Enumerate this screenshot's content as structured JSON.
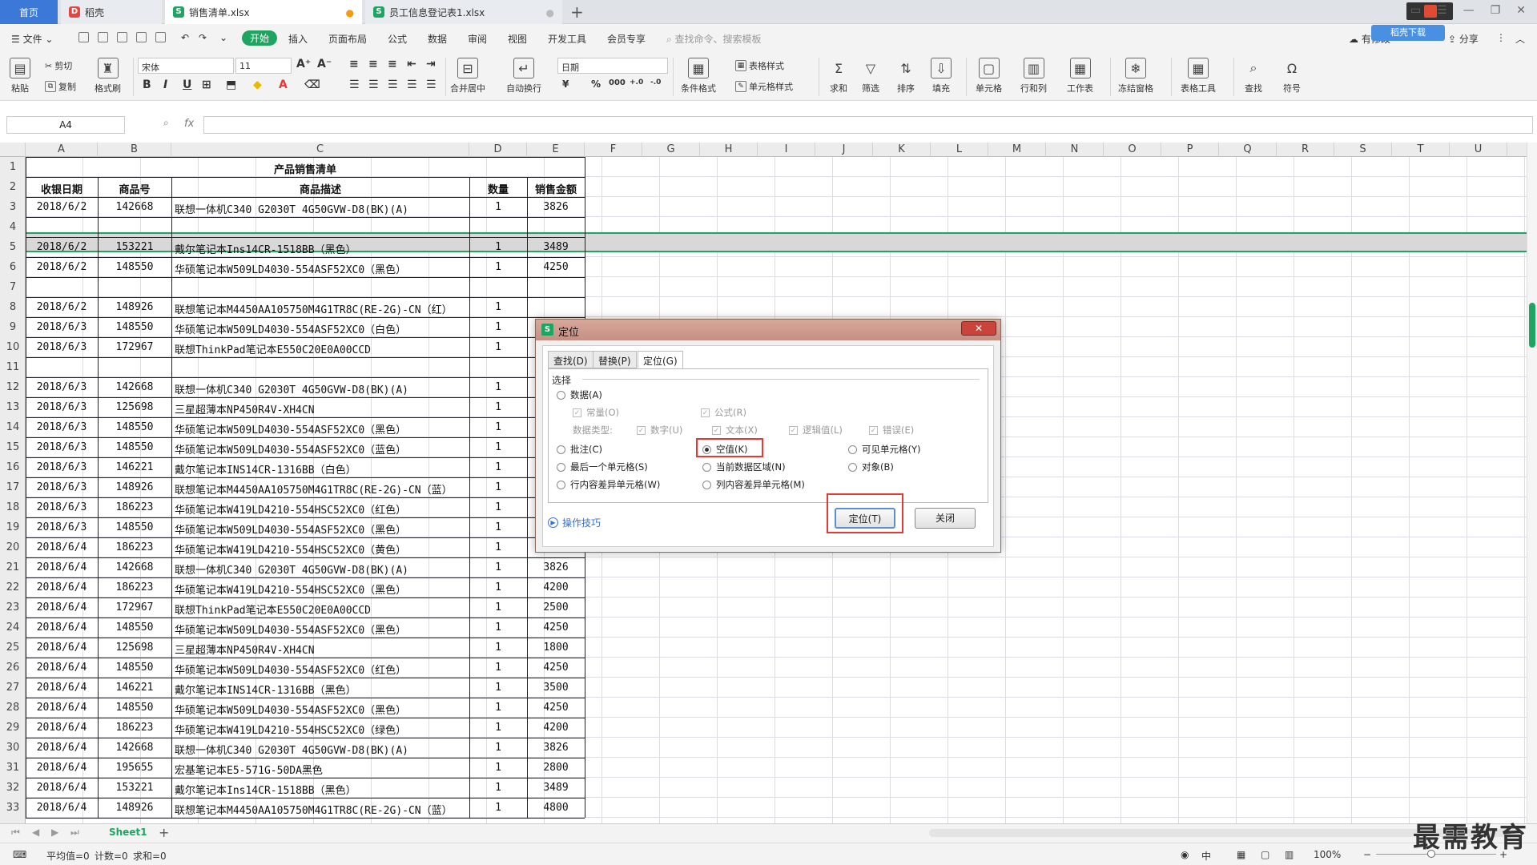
{
  "tabs": {
    "home": "首页",
    "t1": "稻壳",
    "t2": "销售清单.xlsx",
    "t3": "员工信息登记表1.xlsx",
    "new": "+"
  },
  "menubar": {
    "file": "文件",
    "items": [
      "开始",
      "插入",
      "页面布局",
      "公式",
      "数据",
      "审阅",
      "视图",
      "开发工具",
      "会员专享"
    ],
    "search_placeholder": "查找命令、搜索模板",
    "right": [
      "有修改",
      "分享"
    ],
    "badge": "稻壳下载"
  },
  "ribbon": {
    "paste": "粘贴",
    "cut": "剪切",
    "copy": "复制",
    "format_painter": "格式刷",
    "font_name": "宋体",
    "font_size": "11",
    "merge": "合并居中",
    "wrap": "自动换行",
    "number_format": "日期",
    "cond_format": "条件格式",
    "table_style": "表格样式",
    "cell_style": "单元格样式",
    "sum": "求和",
    "filter": "筛选",
    "sort": "排序",
    "fill": "填充",
    "cell": "单元格",
    "rowcol": "行和列",
    "sheet": "工作表",
    "freeze": "冻结窗格",
    "table_tools": "表格工具",
    "find": "查找",
    "symbol": "符号"
  },
  "formula": {
    "namebox": "A4",
    "fx": "fx",
    "value": ""
  },
  "columns": [
    "A",
    "B",
    "C",
    "D",
    "E",
    "F",
    "G",
    "H",
    "I",
    "J",
    "K",
    "L",
    "M",
    "N",
    "O",
    "P",
    "Q",
    "R",
    "S",
    "T",
    "U"
  ],
  "rows": [
    "1",
    "2",
    "3",
    "4",
    "5",
    "6",
    "7",
    "8",
    "9",
    "10",
    "11",
    "12",
    "13",
    "14",
    "15",
    "16",
    "17",
    "18",
    "19",
    "20",
    "21",
    "22",
    "23",
    "24",
    "25",
    "26",
    "27",
    "28",
    "29",
    "30",
    "31",
    "32",
    "33"
  ],
  "sheet": {
    "title": "产品销售清单",
    "headers": [
      "收银日期",
      "商品号",
      "商品描述",
      "数量",
      "销售金额"
    ],
    "data": [
      [
        "2018/6/2",
        "142668",
        "联想一体机C340 G2030T 4G50GVW-D8(BK)(A)",
        "1",
        "3826"
      ],
      [
        "",
        "",
        "",
        "",
        ""
      ],
      [
        "2018/6/2",
        "153221",
        "戴尔笔记本Ins14CR-1518BB（黑色）",
        "1",
        "3489"
      ],
      [
        "2018/6/2",
        "148550",
        "华硕笔记本W509LD4030-554ASF52XC0（黑色）",
        "1",
        "4250"
      ],
      [
        "",
        "",
        "",
        "",
        ""
      ],
      [
        "2018/6/2",
        "148926",
        "联想笔记本M4450AA105750M4G1TR8C(RE-2G)-CN（红）",
        "1",
        ""
      ],
      [
        "2018/6/3",
        "148550",
        "华硕笔记本W509LD4030-554ASF52XC0（白色）",
        "1",
        ""
      ],
      [
        "2018/6/3",
        "172967",
        "联想ThinkPad笔记本E550C20E0A00CCD",
        "1",
        ""
      ],
      [
        "",
        "",
        "",
        "",
        ""
      ],
      [
        "2018/6/3",
        "142668",
        "联想一体机C340 G2030T 4G50GVW-D8(BK)(A)",
        "1",
        ""
      ],
      [
        "2018/6/3",
        "125698",
        "三星超薄本NP450R4V-XH4CN",
        "1",
        ""
      ],
      [
        "2018/6/3",
        "148550",
        "华硕笔记本W509LD4030-554ASF52XC0（黑色）",
        "1",
        ""
      ],
      [
        "2018/6/3",
        "148550",
        "华硕笔记本W509LD4030-554ASF52XC0（蓝色）",
        "1",
        ""
      ],
      [
        "2018/6/3",
        "146221",
        "戴尔笔记本INS14CR-1316BB（白色）",
        "1",
        ""
      ],
      [
        "2018/6/3",
        "148926",
        "联想笔记本M4450AA105750M4G1TR8C(RE-2G)-CN（蓝）",
        "1",
        ""
      ],
      [
        "2018/6/3",
        "186223",
        "华硕笔记本W419LD4210-554HSC52XC0（红色）",
        "1",
        ""
      ],
      [
        "2018/6/3",
        "148550",
        "华硕笔记本W509LD4030-554ASF52XC0（黑色）",
        "1",
        ""
      ],
      [
        "2018/6/4",
        "186223",
        "华硕笔记本W419LD4210-554HSC52XC0（黄色）",
        "1",
        "4200"
      ],
      [
        "2018/6/4",
        "142668",
        "联想一体机C340 G2030T 4G50GVW-D8(BK)(A)",
        "1",
        "3826"
      ],
      [
        "2018/6/4",
        "186223",
        "华硕笔记本W419LD4210-554HSC52XC0（黑色）",
        "1",
        "4200"
      ],
      [
        "2018/6/4",
        "172967",
        "联想ThinkPad笔记本E550C20E0A00CCD",
        "1",
        "2500"
      ],
      [
        "2018/6/4",
        "148550",
        "华硕笔记本W509LD4030-554ASF52XC0（黑色）",
        "1",
        "4250"
      ],
      [
        "2018/6/4",
        "125698",
        "三星超薄本NP450R4V-XH4CN",
        "1",
        "1800"
      ],
      [
        "2018/6/4",
        "148550",
        "华硕笔记本W509LD4030-554ASF52XC0（红色）",
        "1",
        "4250"
      ],
      [
        "2018/6/4",
        "146221",
        "戴尔笔记本INS14CR-1316BB（黑色）",
        "1",
        "3500"
      ],
      [
        "2018/6/4",
        "148550",
        "华硕笔记本W509LD4030-554ASF52XC0（黑色）",
        "1",
        "4250"
      ],
      [
        "2018/6/4",
        "186223",
        "华硕笔记本W419LD4210-554HSC52XC0（绿色）",
        "1",
        "4200"
      ],
      [
        "2018/6/4",
        "142668",
        "联想一体机C340 G2030T 4G50GVW-D8(BK)(A)",
        "1",
        "3826"
      ],
      [
        "2018/6/4",
        "195655",
        "宏基笔记本E5-571G-50DA黑色",
        "1",
        "2800"
      ],
      [
        "2018/6/4",
        "153221",
        "戴尔笔记本Ins14CR-1518BB（黑色）",
        "1",
        "3489"
      ],
      [
        "2018/6/4",
        "148926",
        "联想笔记本M4450AA105750M4G1TR8C(RE-2G)-CN（蓝）",
        "1",
        "4800"
      ]
    ]
  },
  "dialog": {
    "title": "定位",
    "tabs": [
      "查找(D)",
      "替换(P)",
      "定位(G)"
    ],
    "group": "选择",
    "opt_data": "数据(A)",
    "sub_const": "常量(O)",
    "sub_formula": "公式(R)",
    "type_label": "数据类型:",
    "type_num": "数字(U)",
    "type_text": "文本(X)",
    "type_logic": "逻辑值(L)",
    "type_err": "错误(E)",
    "opt_comment": "批注(C)",
    "opt_blank": "空值(K)",
    "opt_visible": "可见单元格(Y)",
    "opt_last": "最后一个单元格(S)",
    "opt_region": "当前数据区域(N)",
    "opt_object": "对象(B)",
    "opt_rowdiff": "行内容差异单元格(W)",
    "opt_coldiff": "列内容差异单元格(M)",
    "tips": "操作技巧",
    "btn_locate": "定位(T)",
    "btn_close": "关闭",
    "close_x": "✕"
  },
  "sheetbar": {
    "sheet": "Sheet1",
    "add": "+"
  },
  "status": {
    "avg": "平均值=0",
    "count": "计数=0",
    "sum": "求和=0",
    "zoom": "100%"
  },
  "watermark": "最需教育",
  "colors": {
    "accent": "#1fa462",
    "highlight": "#e53935"
  }
}
